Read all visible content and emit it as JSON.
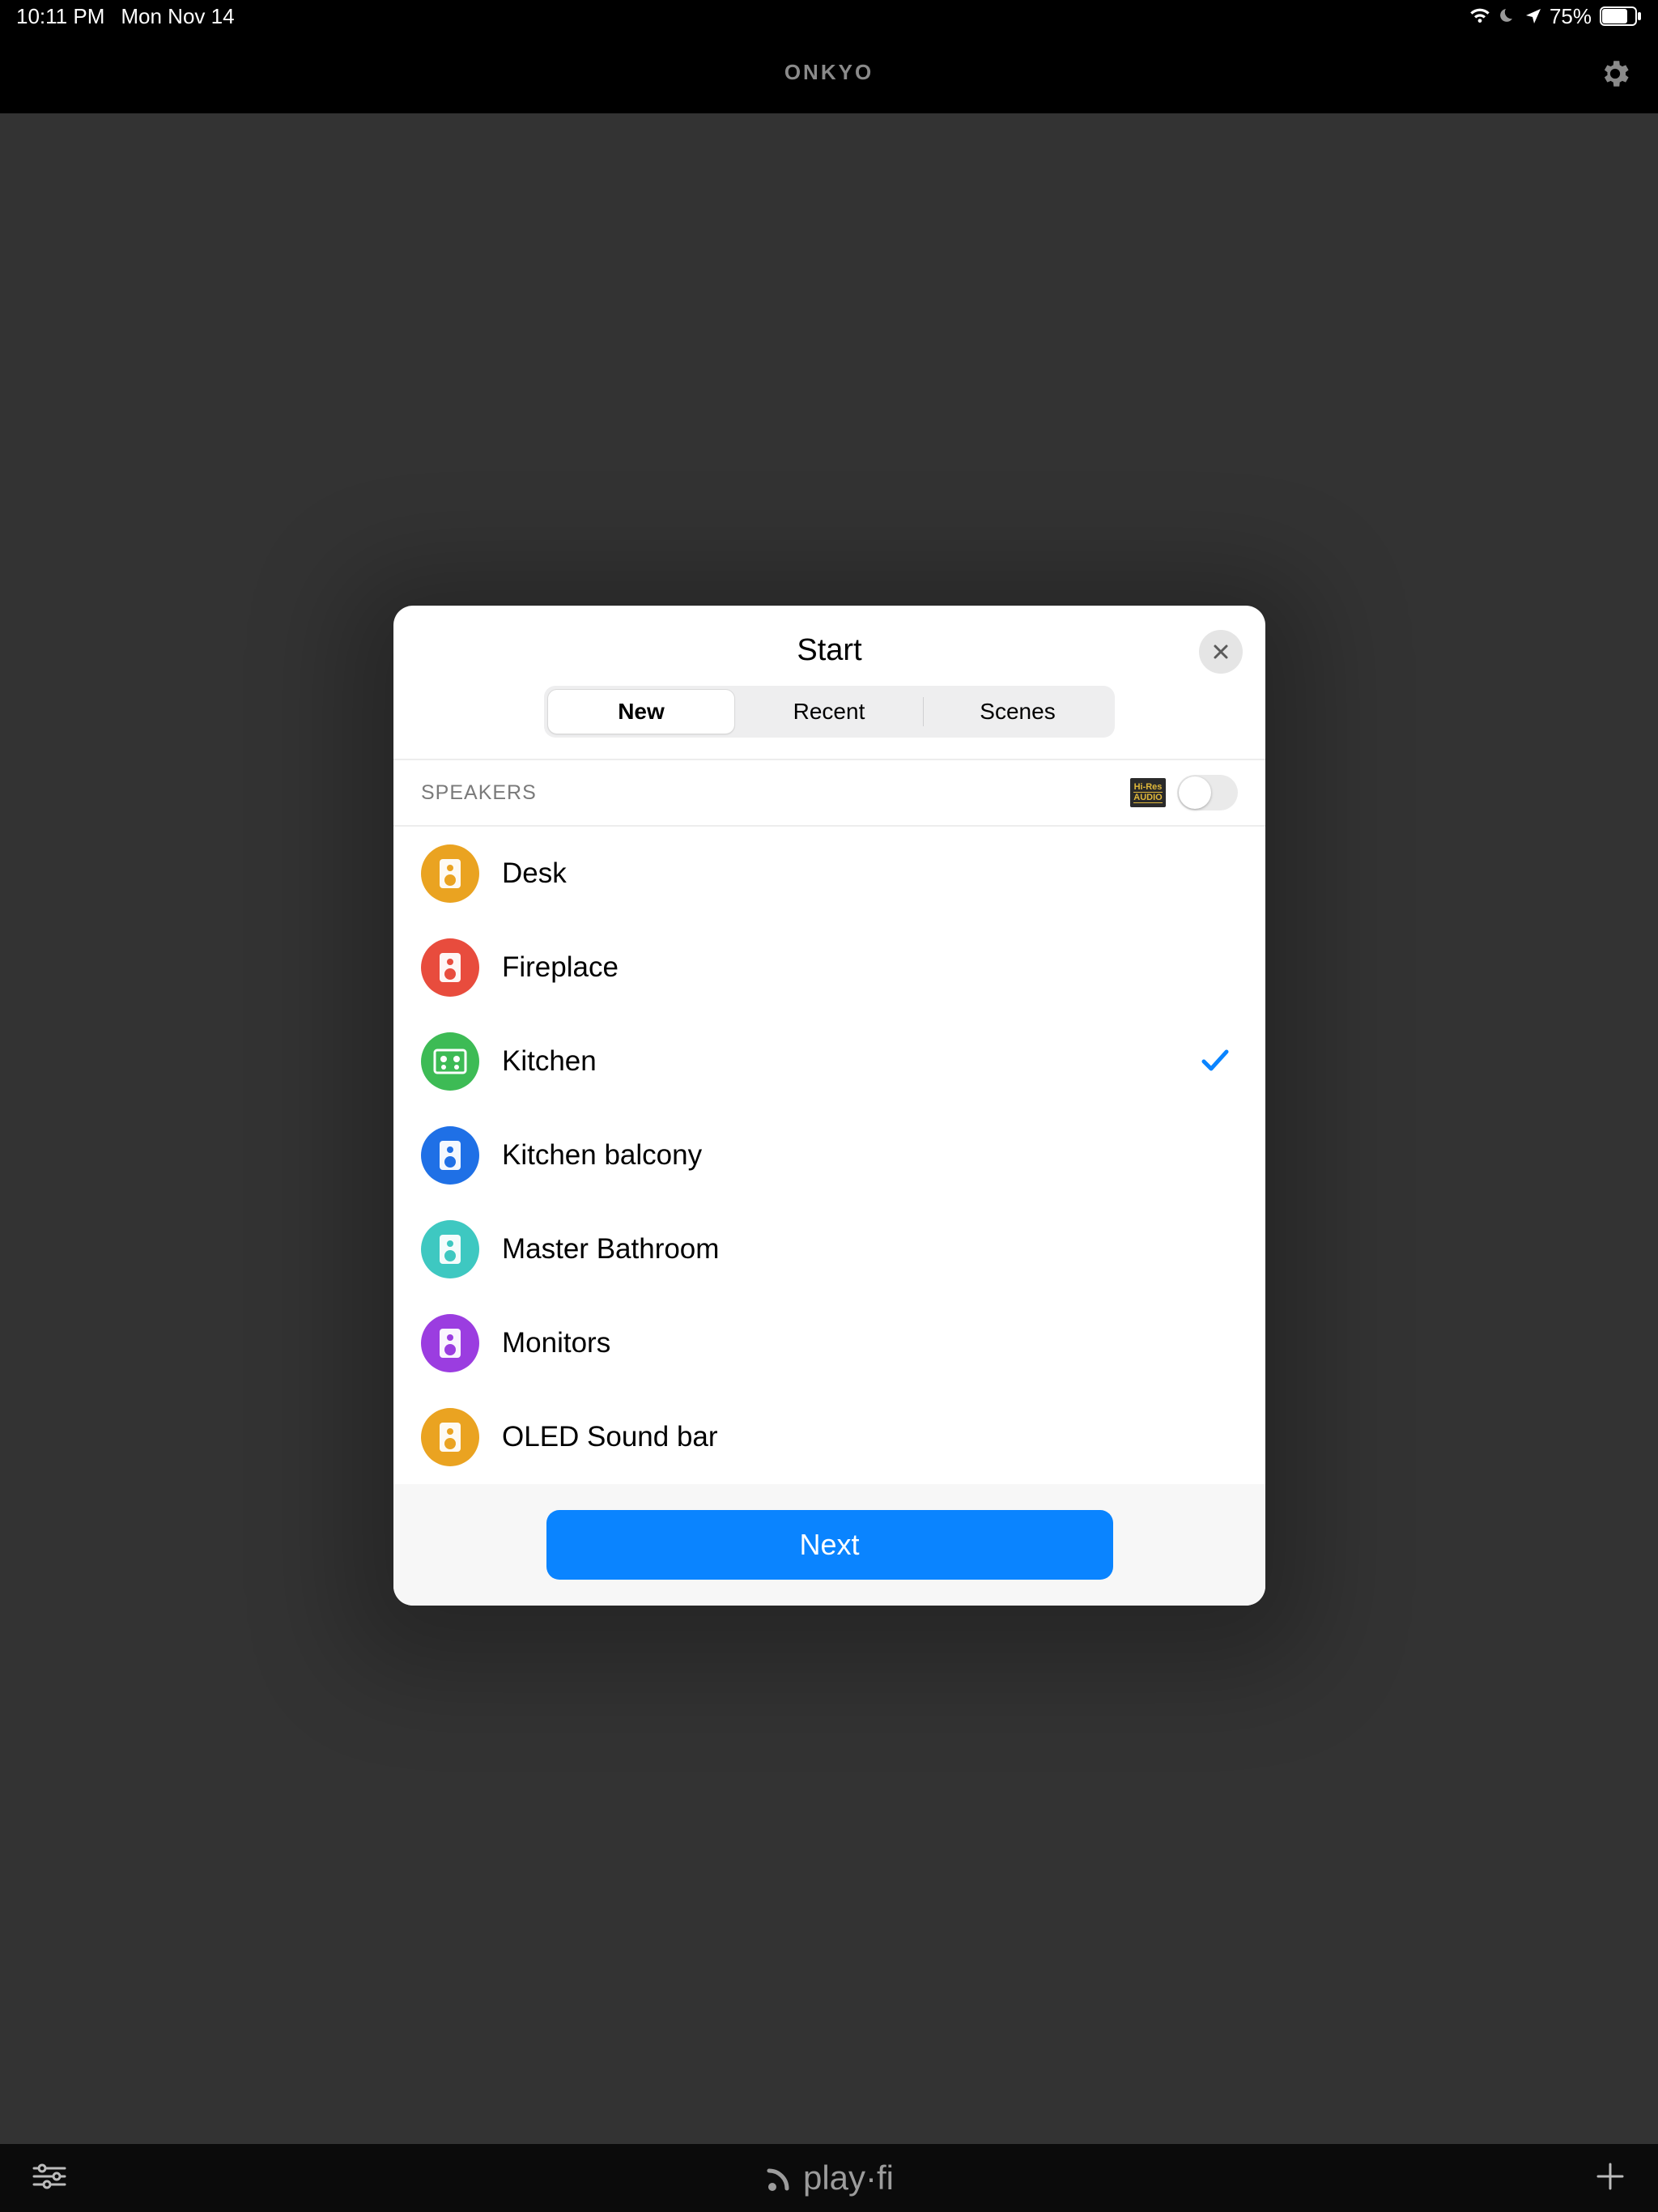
{
  "status": {
    "time": "10:11 PM",
    "date": "Mon Nov 14",
    "battery": "75%"
  },
  "header": {
    "brand": "ONKYO"
  },
  "modal": {
    "title": "Start",
    "tabs": {
      "new": "New",
      "recent": "Recent",
      "scenes": "Scenes"
    },
    "active_tab": "New",
    "section_label": "SPEAKERS",
    "hires_top": "Hi-Res",
    "hires_bot": "AUDIO",
    "hires_toggle_on": false,
    "speakers": [
      {
        "name": "Desk",
        "color": "#eaa321",
        "selected": false,
        "type": "speaker"
      },
      {
        "name": "Fireplace",
        "color": "#e84c3d",
        "selected": false,
        "type": "speaker"
      },
      {
        "name": "Kitchen",
        "color": "#3dbb55",
        "selected": true,
        "type": "receiver"
      },
      {
        "name": "Kitchen balcony",
        "color": "#1f70e6",
        "selected": false,
        "type": "speaker"
      },
      {
        "name": "Master Bathroom",
        "color": "#3ec8c1",
        "selected": false,
        "type": "speaker"
      },
      {
        "name": "Monitors",
        "color": "#9b3de0",
        "selected": false,
        "type": "speaker"
      },
      {
        "name": "OLED Sound bar",
        "color": "#eaa321",
        "selected": false,
        "type": "speaker"
      }
    ],
    "next_label": "Next"
  },
  "tabbar": {
    "brand": "play·fi"
  }
}
